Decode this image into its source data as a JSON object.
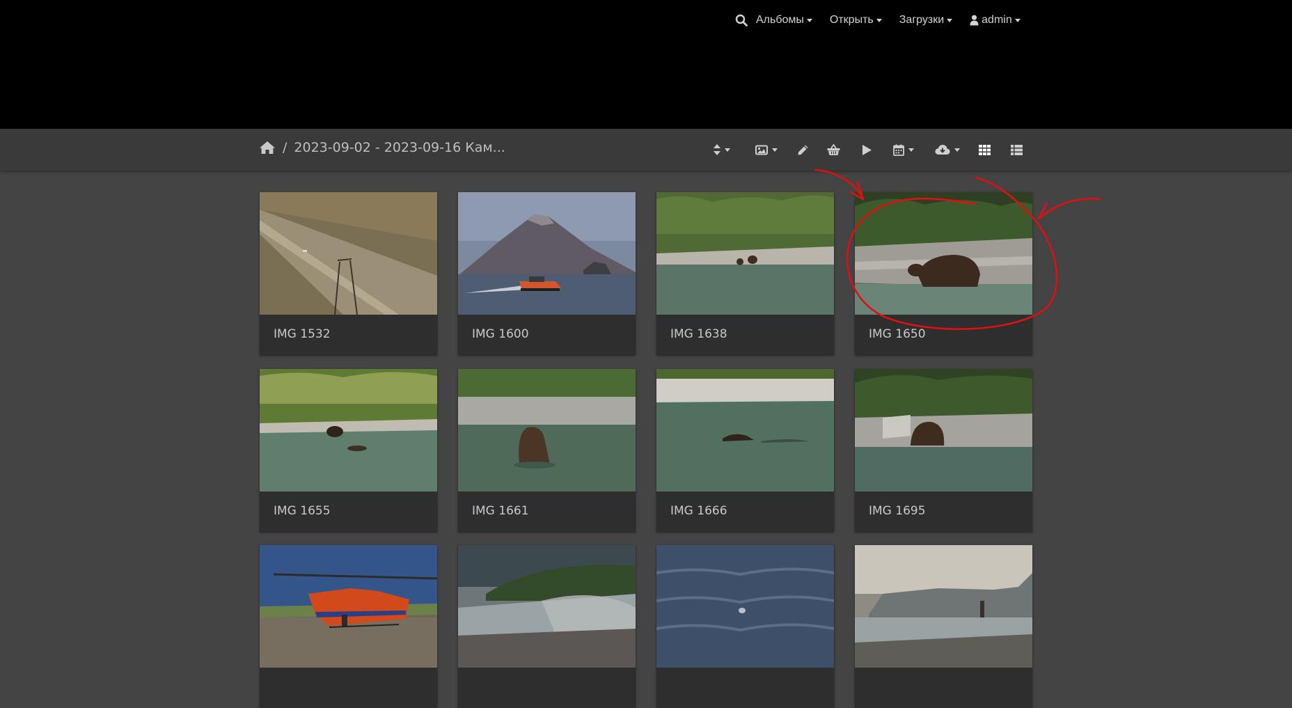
{
  "nav": {
    "albums": "Альбомы",
    "open": "Открыть",
    "downloads": "Загрузки",
    "user": "admin"
  },
  "breadcrumb": {
    "separator": "/",
    "album_title": "2023-09-02 - 2023-09-16 Кам..."
  },
  "gallery": {
    "items": [
      {
        "caption": "IMG 1532"
      },
      {
        "caption": "IMG 1600"
      },
      {
        "caption": "IMG 1638"
      },
      {
        "caption": "IMG 1650"
      },
      {
        "caption": "IMG 1655"
      },
      {
        "caption": "IMG 1661"
      },
      {
        "caption": "IMG 1666"
      },
      {
        "caption": "IMG 1695"
      },
      {
        "caption": ""
      },
      {
        "caption": ""
      },
      {
        "caption": ""
      },
      {
        "caption": ""
      }
    ]
  },
  "colors": {
    "topbar": "#000000",
    "toolbar": "#3a3a3a",
    "page_bg": "#444444",
    "card_bg": "#2e2e2e",
    "annotation": "#e01010"
  }
}
